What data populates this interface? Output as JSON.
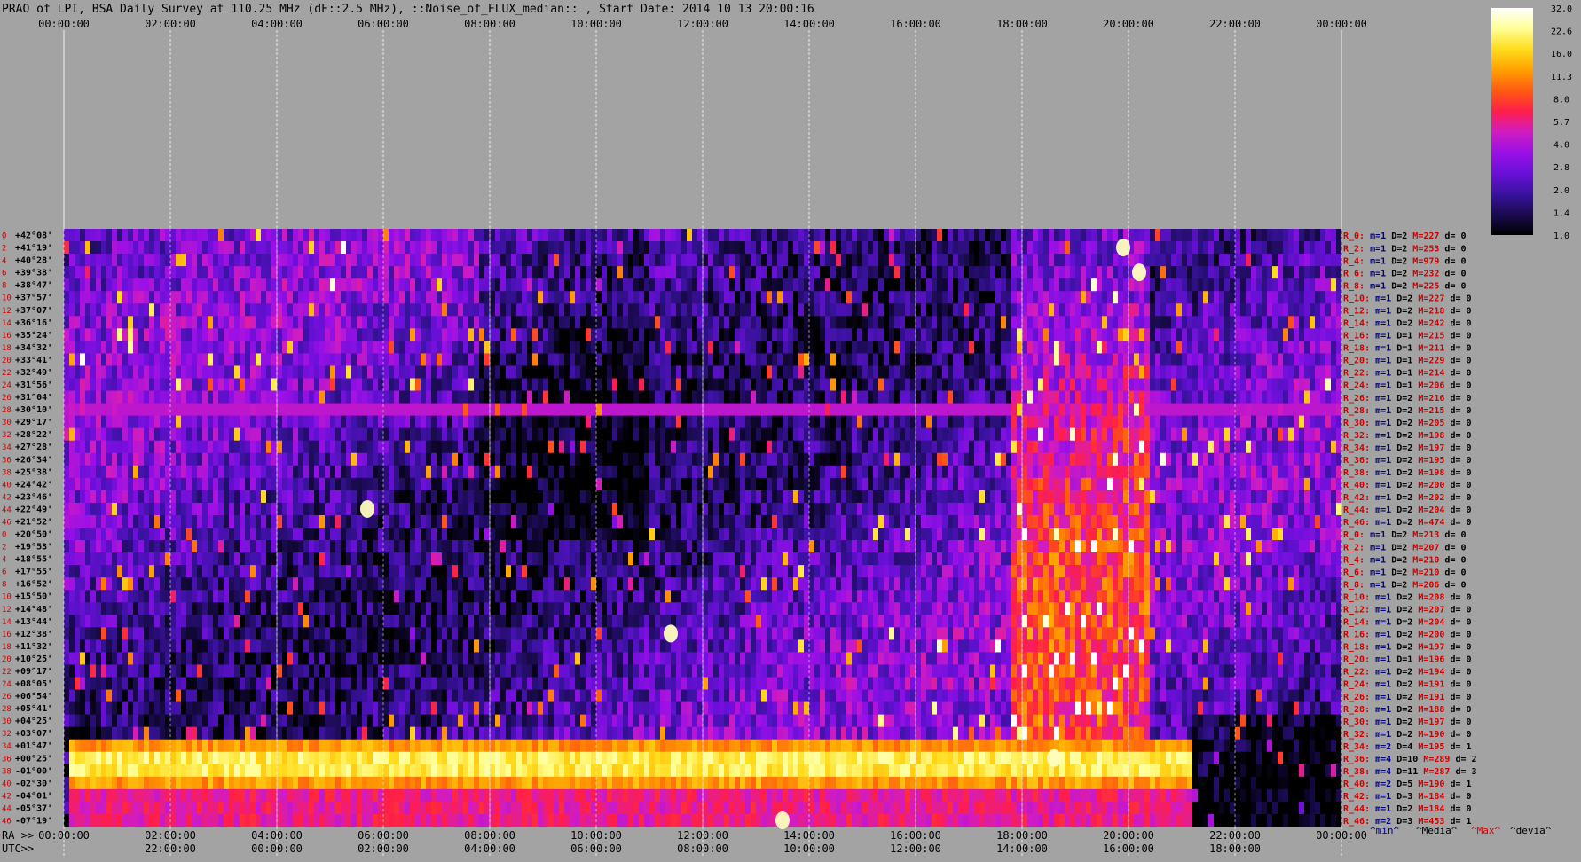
{
  "title": "PRAO of LPI, BSA Daily Survey at 110.25 MHz (dF::2.5 MHz), ::Noise_of_FLUX_median:: , Start Date: 2014 10 13 20:00:16",
  "colors": {
    "background": "#a3a3a3",
    "text": "#000000",
    "row_label": "#d00000",
    "min_label": "#000080",
    "max_label": "#d00000"
  },
  "chart_data": {
    "type": "heatmap",
    "title": "PRAO of LPI, BSA Daily Survey at 110.25 MHz (dF::2.5 MHz), ::Noise_of_FLUX_median:: , Start Date: 2014 10 13 20:00:16",
    "x_top_ticks": [
      "00:00:00",
      "02:00:00",
      "04:00:00",
      "06:00:00",
      "08:00:00",
      "10:00:00",
      "12:00:00",
      "14:00:00",
      "16:00:00",
      "18:00:00",
      "20:00:00",
      "22:00:00",
      "00:00:00"
    ],
    "x_ra_label": "RA >>",
    "x_ra_ticks": [
      "00:00:00",
      "02:00:00",
      "04:00:00",
      "06:00:00",
      "08:00:00",
      "10:00:00",
      "12:00:00",
      "14:00:00",
      "16:00:00",
      "18:00:00",
      "20:00:00",
      "22:00:00",
      "00:00:00"
    ],
    "x_utc_label": "UTC>>",
    "x_utc_ticks": [
      "22:00:00",
      "00:00:00",
      "02:00:00",
      "04:00:00",
      "06:00:00",
      "08:00:00",
      "10:00:00",
      "12:00:00",
      "14:00:00",
      "16:00:00",
      "18:00:00"
    ],
    "x_range_hours": [
      0,
      24
    ],
    "row_indices": [
      "0",
      "2",
      "4",
      "6",
      "8",
      "10",
      "12",
      "14",
      "16",
      "18",
      "20",
      "22",
      "24",
      "26",
      "28",
      "30",
      "32",
      "34",
      "36",
      "38",
      "40",
      "42",
      "44",
      "46",
      "0",
      "2",
      "4",
      "6",
      "8",
      "10",
      "12",
      "14",
      "16",
      "18",
      "20",
      "22",
      "24",
      "26",
      "28",
      "30",
      "32",
      "34",
      "36",
      "38",
      "40",
      "42",
      "44",
      "46"
    ],
    "declinations": [
      "+42°08'",
      "+41°19'",
      "+40°28'",
      "+39°38'",
      "+38°47'",
      "+37°57'",
      "+37°07'",
      "+36°16'",
      "+35°24'",
      "+34°32'",
      "+33°41'",
      "+32°49'",
      "+31°56'",
      "+31°04'",
      "+30°10'",
      "+29°17'",
      "+28°22'",
      "+27°28'",
      "+26°34'",
      "+25°38'",
      "+24°42'",
      "+23°46'",
      "+22°49'",
      "+21°52'",
      "+20°50'",
      "+19°53'",
      "+18°55'",
      "+17°55'",
      "+16°52'",
      "+15°50'",
      "+14°48'",
      "+13°44'",
      "+12°38'",
      "+11°32'",
      "+10°25'",
      "+09°17'",
      "+08°05'",
      "+06°54'",
      "+05°41'",
      "+04°25'",
      "+03°07'",
      "+01°47'",
      "+00°25'",
      "-01°00'",
      "-02°30'",
      "-04°01'",
      "-05°37'",
      "-07°19'"
    ],
    "right_stats": [
      [
        "R_0:",
        "1",
        "2",
        "227",
        "0"
      ],
      [
        "R_2:",
        "1",
        "2",
        "253",
        "0"
      ],
      [
        "R_4:",
        "1",
        "2",
        "979",
        "0"
      ],
      [
        "R_6:",
        "1",
        "2",
        "232",
        "0"
      ],
      [
        "R_8:",
        "1",
        "2",
        "225",
        "0"
      ],
      [
        "R_10:",
        "1",
        "2",
        "227",
        "0"
      ],
      [
        "R_12:",
        "1",
        "2",
        "218",
        "0"
      ],
      [
        "R_14:",
        "1",
        "2",
        "242",
        "0"
      ],
      [
        "R_16:",
        "1",
        "1",
        "215",
        "0"
      ],
      [
        "R_18:",
        "1",
        "1",
        "211",
        "0"
      ],
      [
        "R_20:",
        "1",
        "1",
        "229",
        "0"
      ],
      [
        "R_22:",
        "1",
        "1",
        "214",
        "0"
      ],
      [
        "R_24:",
        "1",
        "1",
        "206",
        "0"
      ],
      [
        "R_26:",
        "1",
        "2",
        "216",
        "0"
      ],
      [
        "R_28:",
        "1",
        "2",
        "215",
        "0"
      ],
      [
        "R_30:",
        "1",
        "2",
        "205",
        "0"
      ],
      [
        "R_32:",
        "1",
        "2",
        "198",
        "0"
      ],
      [
        "R_34:",
        "1",
        "2",
        "197",
        "0"
      ],
      [
        "R_36:",
        "1",
        "2",
        "195",
        "0"
      ],
      [
        "R_38:",
        "1",
        "2",
        "198",
        "0"
      ],
      [
        "R_40:",
        "1",
        "2",
        "200",
        "0"
      ],
      [
        "R_42:",
        "1",
        "2",
        "202",
        "0"
      ],
      [
        "R_44:",
        "1",
        "2",
        "204",
        "0"
      ],
      [
        "R_46:",
        "1",
        "2",
        "474",
        "0"
      ],
      [
        "R_0:",
        "1",
        "2",
        "213",
        "0"
      ],
      [
        "R_2:",
        "1",
        "2",
        "207",
        "0"
      ],
      [
        "R_4:",
        "1",
        "2",
        "210",
        "0"
      ],
      [
        "R_6:",
        "1",
        "2",
        "210",
        "0"
      ],
      [
        "R_8:",
        "1",
        "2",
        "206",
        "0"
      ],
      [
        "R_10:",
        "1",
        "2",
        "208",
        "0"
      ],
      [
        "R_12:",
        "1",
        "2",
        "207",
        "0"
      ],
      [
        "R_14:",
        "1",
        "2",
        "204",
        "0"
      ],
      [
        "R_16:",
        "1",
        "2",
        "200",
        "0"
      ],
      [
        "R_18:",
        "1",
        "2",
        "197",
        "0"
      ],
      [
        "R_20:",
        "1",
        "1",
        "196",
        "0"
      ],
      [
        "R_22:",
        "1",
        "2",
        "194",
        "0"
      ],
      [
        "R_24:",
        "1",
        "2",
        "191",
        "0"
      ],
      [
        "R_26:",
        "1",
        "2",
        "191",
        "0"
      ],
      [
        "R_28:",
        "1",
        "2",
        "188",
        "0"
      ],
      [
        "R_30:",
        "1",
        "2",
        "197",
        "0"
      ],
      [
        "R_32:",
        "1",
        "2",
        "190",
        "0"
      ],
      [
        "R_34:",
        "2",
        "4",
        "195",
        "1"
      ],
      [
        "R_36:",
        "4",
        "10",
        "289",
        "2"
      ],
      [
        "R_38:",
        "4",
        "11",
        "287",
        "3"
      ],
      [
        "R_40:",
        "2",
        "5",
        "190",
        "1"
      ],
      [
        "R_42:",
        "1",
        "3",
        "184",
        "0"
      ],
      [
        "R_44:",
        "1",
        "2",
        "184",
        "0"
      ],
      [
        "R_46:",
        "2",
        "3",
        "453",
        "1"
      ]
    ],
    "stat_prefixes": {
      "min": "m=",
      "median": "D=",
      "max": "M=",
      "dev": "d="
    },
    "legend_footer": [
      "^min^",
      "^Media^",
      "^Max^",
      "^devia^"
    ],
    "colorbar": {
      "ticks": [
        "32.0",
        "22.6",
        "16.0",
        "11.3",
        "8.0",
        "5.7",
        "4.0",
        "2.8",
        "2.0",
        "1.4",
        "1.0"
      ],
      "range": [
        1.0,
        32.0
      ],
      "scale": "log",
      "colormap": [
        "#000000",
        "#1a0b50",
        "#3a12a0",
        "#6a10d8",
        "#9a10e6",
        "#d21cc0",
        "#ff1e4a",
        "#ff5a10",
        "#ffa000",
        "#ffdc1c",
        "#ffff96",
        "#ffffff"
      ]
    },
    "features": {
      "hot_band_rows": [
        41,
        42,
        43,
        44,
        45,
        46,
        47
      ],
      "hot_band_ra_hours": [
        0.1,
        21.2
      ],
      "horizontal_line_row": 14,
      "bright_sources_ra_dec_rows": [
        [
          19.9,
          1
        ],
        [
          18.6,
          42
        ],
        [
          13.5,
          47
        ],
        [
          11.4,
          32
        ],
        [
          5.7,
          22
        ],
        [
          20.2,
          3
        ]
      ],
      "vertical_bright_ra_hours": [
        4.0,
        8.0,
        12.0,
        16.0,
        18.0,
        20.0
      ]
    }
  }
}
